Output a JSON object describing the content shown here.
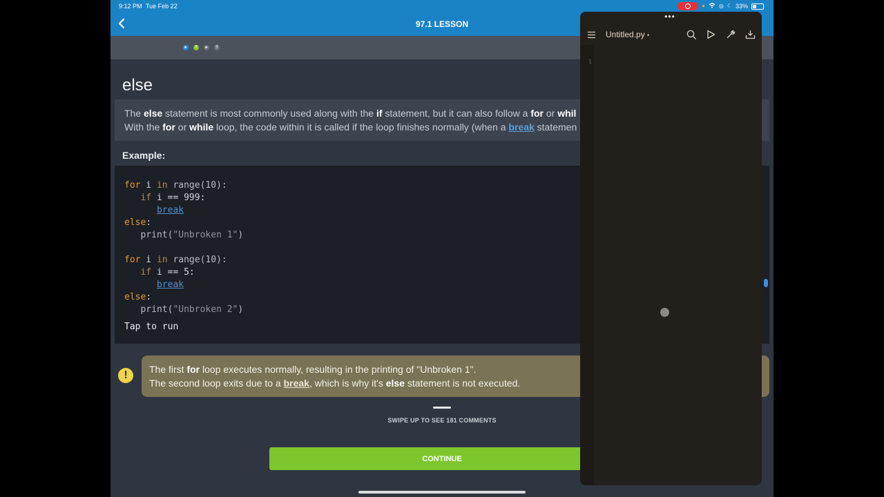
{
  "status": {
    "time": "9:12 PM",
    "date": "Tue Feb 22",
    "battery": "33%"
  },
  "header": {
    "title": "97.1 LESSON"
  },
  "lesson": {
    "section_title": "else",
    "description": {
      "line1_a": "The ",
      "line1_b": "else",
      "line1_c": " statement is most commonly used along with the ",
      "line1_d": "if",
      "line1_e": " statement, but it can also follow a ",
      "line1_f": "for",
      "line1_g": " or ",
      "line1_h": "whil",
      "line2_a": "With the ",
      "line2_b": "for",
      "line2_c": " or ",
      "line2_d": "while",
      "line2_e": " loop, the code within it is called if the loop finishes normally (when a ",
      "line2_f": "break",
      "line2_g": " statemen"
    },
    "example_label": "Example:",
    "code": {
      "l1_kw": "for",
      "l1_var": " i ",
      "l1_in": "in",
      "l1_call": " range(10):",
      "l2_kw": "if",
      "l2_rest": " i == 999:",
      "l3_link": "break",
      "l4_kw": "else",
      "l4_colon": ":",
      "l5_fn": "print(",
      "l5_str": "\"Unbroken 1\"",
      "l5_close": ")",
      "l7_kw": "for",
      "l7_var": " i ",
      "l7_in": "in",
      "l7_call": " range(10):",
      "l8_kw": "if",
      "l8_rest": " i == 5:",
      "l9_link": "break",
      "l10_kw": "else",
      "l10_colon": ":",
      "l11_fn": "print(",
      "l11_str": "\"Unbroken 2\"",
      "l11_close": ")"
    },
    "tap_to_run": "Tap to run",
    "note": {
      "line1_a": "The first ",
      "line1_b": "for",
      "line1_c": " loop executes normally, resulting in the printing of \"Unbroken 1\".",
      "line2_a": "The second loop exits due to a ",
      "line2_b": "break",
      "line2_c": ", which is why it's ",
      "line2_d": "else",
      "line2_e": " statement is not executed."
    }
  },
  "footer": {
    "swipe_hint": "SWIPE UP TO SEE 181 COMMENTS",
    "continue_label": "CONTINUE"
  },
  "editor": {
    "filename": "Untitled.py",
    "filename_marker": "•",
    "line_number": "1"
  },
  "colors": {
    "header_blue": "#1a83c6",
    "continue_green": "#7ec62d",
    "keyword_orange": "#e09a3b",
    "link_blue": "#4f8fd0",
    "note_bg": "#7b7355"
  }
}
